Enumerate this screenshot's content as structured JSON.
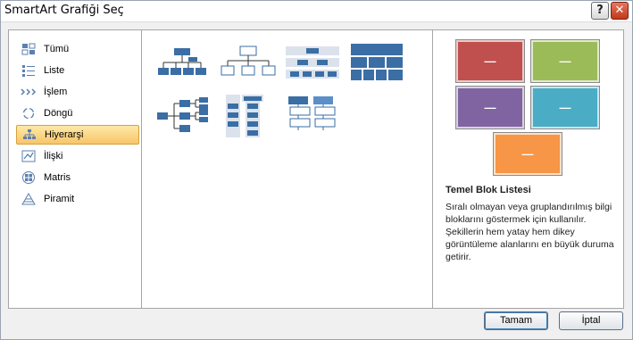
{
  "window": {
    "title": "SmartArt Grafiği Seç",
    "help": "?",
    "close": "✕"
  },
  "categories": [
    {
      "label": "Tümü",
      "icon": "all-icon"
    },
    {
      "label": "Liste",
      "icon": "list-icon"
    },
    {
      "label": "İşlem",
      "icon": "process-icon"
    },
    {
      "label": "Döngü",
      "icon": "cycle-icon"
    },
    {
      "label": "Hiyerarşi",
      "icon": "hierarchy-icon",
      "selected": true
    },
    {
      "label": "İlişki",
      "icon": "relationship-icon"
    },
    {
      "label": "Matris",
      "icon": "matrix-icon"
    },
    {
      "label": "Piramit",
      "icon": "pyramid-icon"
    }
  ],
  "preview": {
    "dash": "—",
    "colors": [
      "#c0504d",
      "#9bbb59",
      "#8064a2",
      "#4bacc6",
      "#f79646"
    ],
    "title": "Temel Blok Listesi",
    "description": "Sıralı olmayan veya gruplandırılmış bilgi bloklarını göstermek için kullanılır. Şekillerin hem yatay hem dikey görüntüleme alanlarını en büyük duruma getirir."
  },
  "buttons": {
    "ok": "Tamam",
    "cancel": "İptal"
  }
}
